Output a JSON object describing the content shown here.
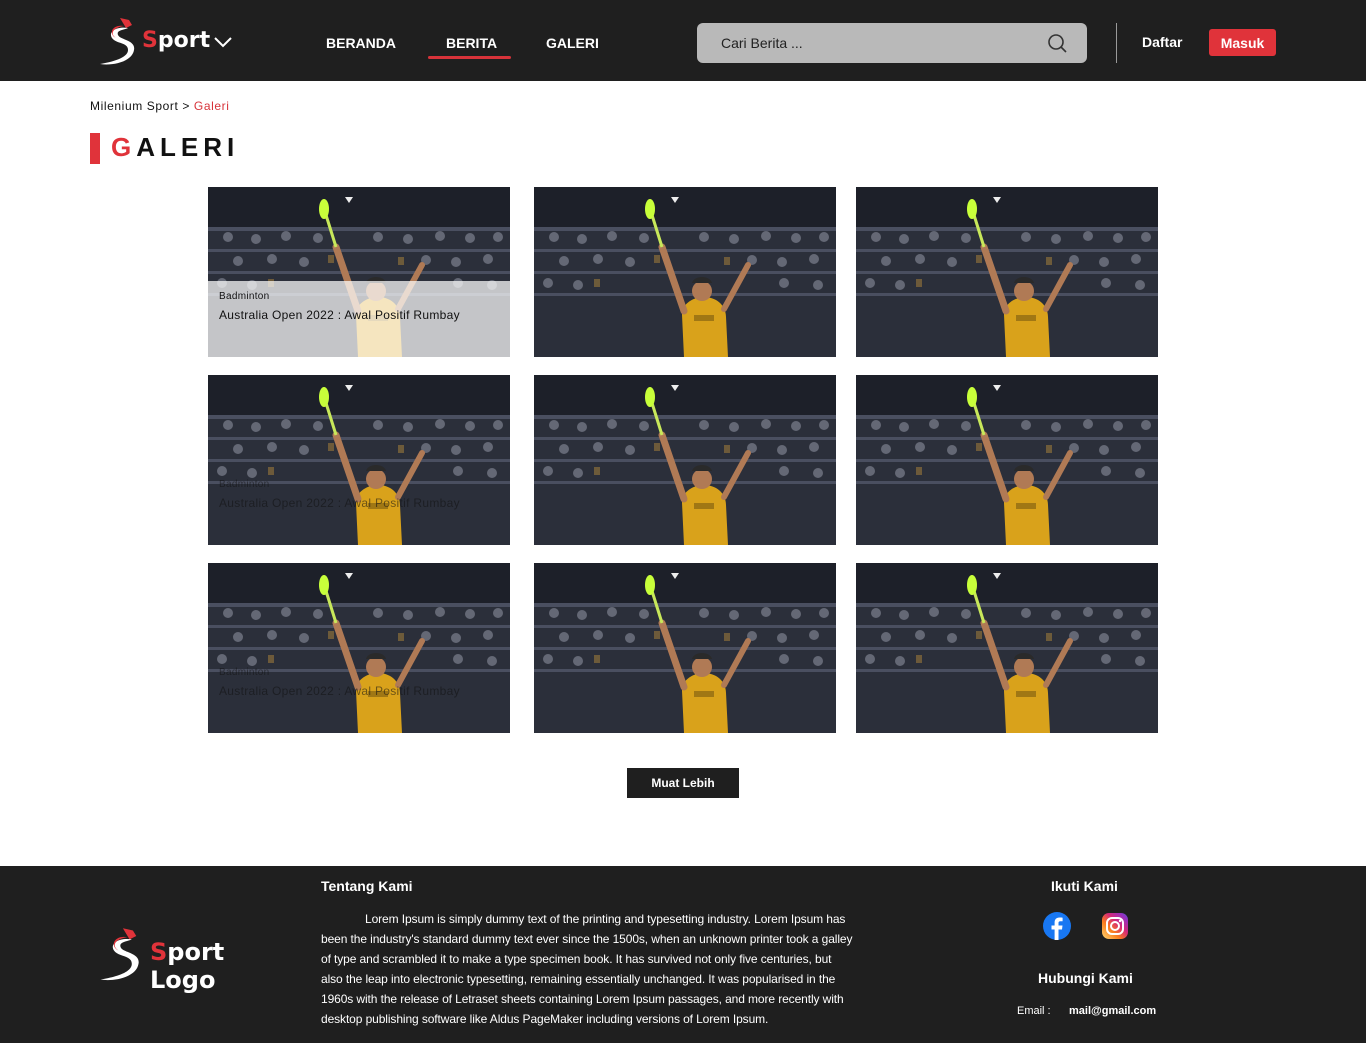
{
  "header": {
    "logo_s": "S",
    "logo_rest": "port",
    "nav": {
      "beranda": "BERANDA",
      "berita": "BERITA",
      "galeri": "GALERI"
    },
    "search_placeholder": "Cari Berita ...",
    "register": "Daftar",
    "login": "Masuk"
  },
  "breadcrumb": {
    "root": "Milenium Sport",
    "sep": " > ",
    "current": "Galeri"
  },
  "page_title": {
    "first": "G",
    "rest": "ALERI"
  },
  "gallery": [
    {
      "category": "Badminton",
      "title": "Australia Open 2022 : Awal Positif Rumbay",
      "caption": "strong"
    },
    {
      "category": "",
      "title": "",
      "caption": "none"
    },
    {
      "category": "",
      "title": "",
      "caption": "none"
    },
    {
      "category": "Badminton",
      "title": "Australia Open 2022 : Awal Positif Rumbay",
      "caption": "faint"
    },
    {
      "category": "",
      "title": "",
      "caption": "none"
    },
    {
      "category": "",
      "title": "",
      "caption": "none"
    },
    {
      "category": "Badminton",
      "title": "Australia Open 2022 : Awal Positif Rumbay",
      "caption": "faint"
    },
    {
      "category": "",
      "title": "",
      "caption": "none"
    },
    {
      "category": "",
      "title": "",
      "caption": "none"
    }
  ],
  "load_more": "Muat Lebih",
  "footer": {
    "logo_s": "S",
    "logo_rest": "port Logo",
    "about_title": "Tentang Kami",
    "about_text": "Lorem Ipsum is simply dummy text of the printing and typesetting industry. Lorem Ipsum has been the industry's standard dummy text ever since the 1500s, when an unknown printer took a galley of type and scrambled it to make a type specimen book. It has survived not only five centuries, but also the leap into electronic typesetting, remaining essentially unchanged. It was popularised in the 1960s with the release of Letraset sheets containing Lorem Ipsum passages, and more recently with desktop publishing software like Aldus PageMaker including versions of Lorem Ipsum.",
    "follow_title": "Ikuti Kami",
    "contact_title": "Hubungi Kami",
    "email_label": "Email :",
    "email_value": "mail@gmail.com"
  },
  "colors": {
    "accent": "#e0333a",
    "dark": "#1f1f1f"
  }
}
